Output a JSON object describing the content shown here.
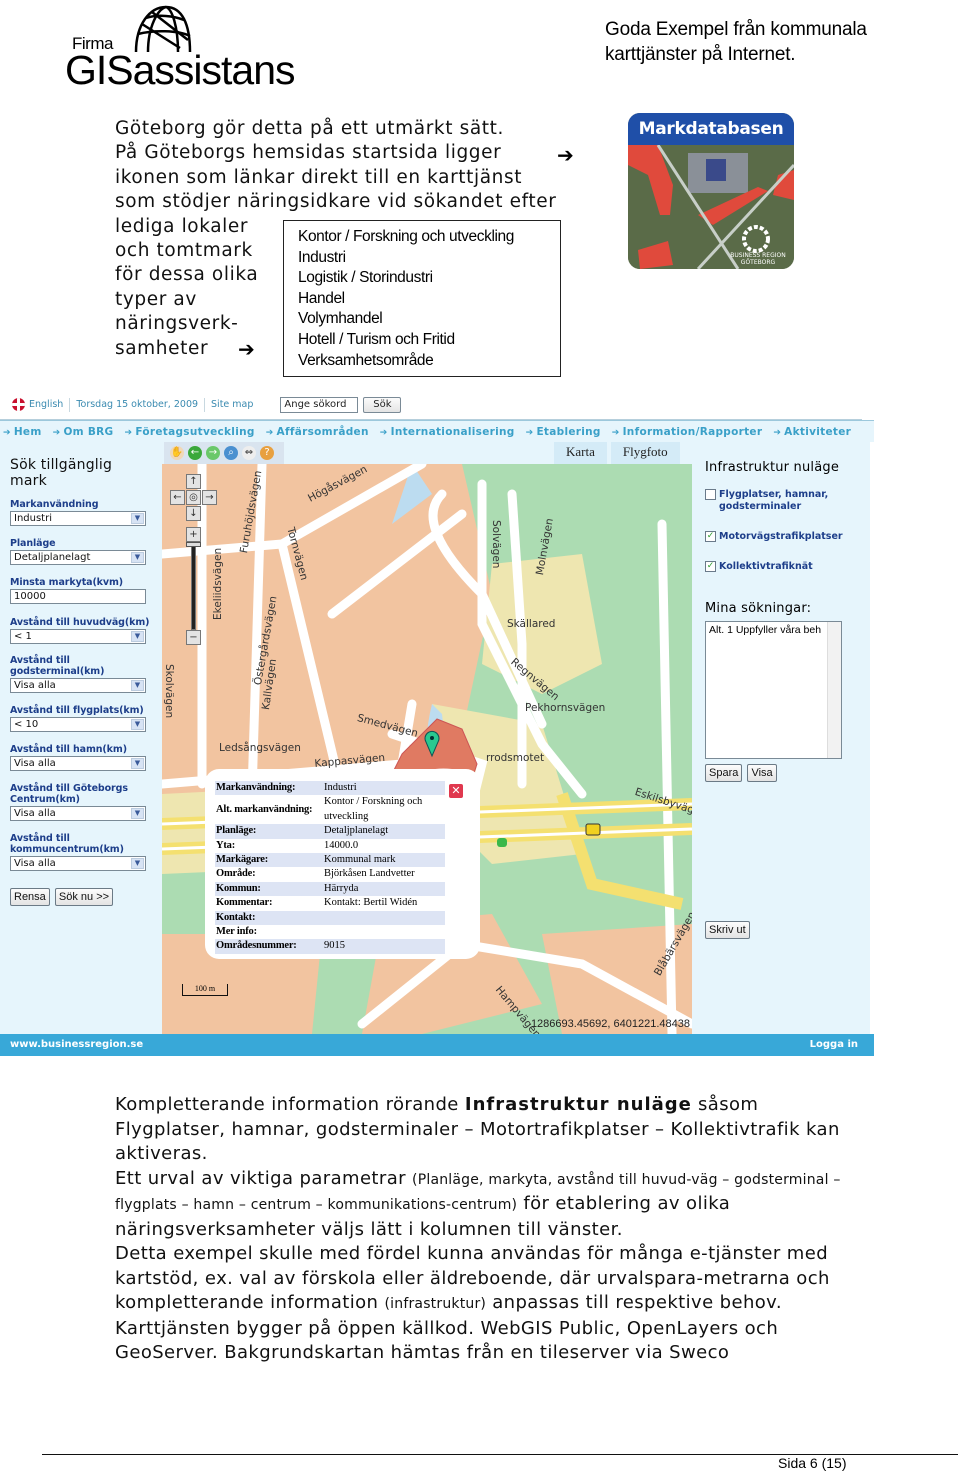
{
  "header": {
    "logo_prefix": "Firma",
    "logo_brand": "GISassistans",
    "doc_title_line1": "Goda Exempel från kommunala",
    "doc_title_line2": "karttjänster på Internet."
  },
  "intro": {
    "lines": [
      "Göteborg gör detta på ett utmärkt sätt.",
      "På Göteborgs hemsidas startsida ligger",
      "ikonen  som länkar direkt till en karttjänst",
      "som stödjer näringsidkare vid sökandet efter",
      "lediga lokaler",
      "och tomtmark",
      "för dessa olika",
      "typer av",
      "näringsverk-",
      "samheter"
    ],
    "arrow_glyph": "➔"
  },
  "business_types": [
    "Kontor / Forskning och utveckling",
    "Industri",
    "Logistik / Storindustri",
    "Handel",
    "Volymhandel",
    "Hotell / Turism och Fritid",
    "Verksamhetsområde"
  ],
  "markdatabasen_icon": {
    "title": "Markdatabasen",
    "caption_line1": "BUSINESS REGION",
    "caption_line2": "GÖTEBORG"
  },
  "app": {
    "topbar": {
      "language": "English",
      "date": "Torsdag 15 oktober, 2009",
      "sitemap": "Site map",
      "search_placeholder": "Ange sökord",
      "search_button": "Sök"
    },
    "nav": [
      "Hem",
      "Om BRG",
      "Företagsutveckling",
      "Affärsområden",
      "Internationalisering",
      "Etablering",
      "Information/Rapporter",
      "Aktiviteter"
    ],
    "left_panel": {
      "title": "Sök tillgänglig mark",
      "fields": [
        {
          "label": "Markanvändning",
          "value": "Industri",
          "type": "select"
        },
        {
          "label": "Planläge",
          "value": "Detaljplanelagt",
          "type": "select"
        },
        {
          "label": "Minsta markyta(kvm)",
          "value": "10000",
          "type": "input"
        },
        {
          "label": "Avstånd till huvudväg(km)",
          "value": "< 1",
          "type": "select"
        },
        {
          "label": "Avstånd till godsterminal(km)",
          "value": "Visa alla",
          "type": "select"
        },
        {
          "label": "Avstånd till flygplats(km)",
          "value": "< 10",
          "type": "select"
        },
        {
          "label": "Avstånd till hamn(km)",
          "value": "Visa alla",
          "type": "select"
        },
        {
          "label": "Avstånd till Göteborgs Centrum(km)",
          "value": "Visa alla",
          "type": "select"
        },
        {
          "label": "Avstånd till kommuncentrum(km)",
          "value": "Visa alla",
          "type": "select"
        }
      ],
      "reset_button": "Rensa",
      "search_button": "Sök nu >>"
    },
    "map": {
      "tabs": [
        "Karta",
        "Flygfoto"
      ],
      "toolbar_icons": [
        "pan-hand",
        "back",
        "forward",
        "zoom-box",
        "measure",
        "info"
      ],
      "streets": [
        "Högåsvägen",
        "Furuhöjdsvägen",
        "Tornvägen",
        "Ekeliidsvägen",
        "Östergårdsvägen",
        "Kallvägen",
        "Skolvägen",
        "Ledsångsvägen",
        "Smedvägen",
        "Kappasvägen",
        "Solvägen",
        "Skällared",
        "Molnvägen",
        "Regnvägen",
        "Pekhornsvägen",
        "rrodsmotet",
        "Eskilsbyvägen",
        "Hampvägen",
        "Blåbärsvägen"
      ],
      "scale_label": "100 m",
      "coordinates": "1286693.45692, 6401221.48438",
      "popup": {
        "rows": [
          {
            "key": "Markanvändning:",
            "value": "Industri"
          },
          {
            "key": "Alt. markanvändning:",
            "value": "Kontor / Forskning och utveckling"
          },
          {
            "key": "Planläge:",
            "value": "Detaljplanelagt"
          },
          {
            "key": "Yta:",
            "value": "14000.0"
          },
          {
            "key": "Markägare:",
            "value": "Kommunal mark"
          },
          {
            "key": "Område:",
            "value": "Björkåsen Landvetter"
          },
          {
            "key": "Kommun:",
            "value": "Härryda"
          },
          {
            "key": "Kommentar:",
            "value": "Kontakt: Bertil Widén"
          },
          {
            "key": "Kontakt:",
            "value": ""
          },
          {
            "key": "Mer info:",
            "value": ""
          },
          {
            "key": "Områdesnummer:",
            "value": "9015"
          }
        ]
      }
    },
    "right_panel": {
      "title": "Infrastruktur nuläge",
      "checkboxes": [
        {
          "label": "Flygplatser, hamnar, godsterminaler",
          "checked": false
        },
        {
          "label": "Motorvägstrafikplatser",
          "checked": true
        },
        {
          "label": "Kollektivtrafiknät",
          "checked": true
        }
      ],
      "searches_title": "Mina sökningar:",
      "saved_searches": [
        "Alt. 1 Uppfyller våra beh"
      ],
      "save_button": "Spara",
      "show_button": "Visa",
      "print_button": "Skriv ut"
    },
    "footer": {
      "url": "www.businessregion.se",
      "login": "Logga in"
    }
  },
  "body": {
    "p1_a": "Kompletterande information rörande ",
    "p1_bold": "Infrastruktur nuläge",
    "p1_b": " såsom Flygplatser, hamnar, godsterminaler – Motortrafikplatser – Kollektivtrafik kan aktiveras.",
    "p2_a": "Ett urval av viktiga parametrar ",
    "p2_small": "(Planläge, markyta, avstånd till huvud-väg – godsterminal – flygplats – hamn – centrum – kommunikations-centrum)",
    "p2_b": " för etablering av olika näringsverksamheter väljs lätt i kolumnen till vänster.",
    "p3_a": "Detta exempel skulle med fördel kunna användas för många e-tjänster med kartstöd, ex. val av förskola eller äldreboende, där urvalspara-metrarna och kompletterande information ",
    "p3_small": "(infrastruktur)",
    "p3_b": " anpassas till respektive behov.",
    "p4": "Karttjänsten bygger på öppen källkod. WebGIS Public, OpenLayers och GeoServer. Bakgrundskartan hämtas från en tileserver via Sweco"
  },
  "footer": {
    "page_label": "Sida",
    "page_number": "6",
    "page_total": "(15)"
  }
}
